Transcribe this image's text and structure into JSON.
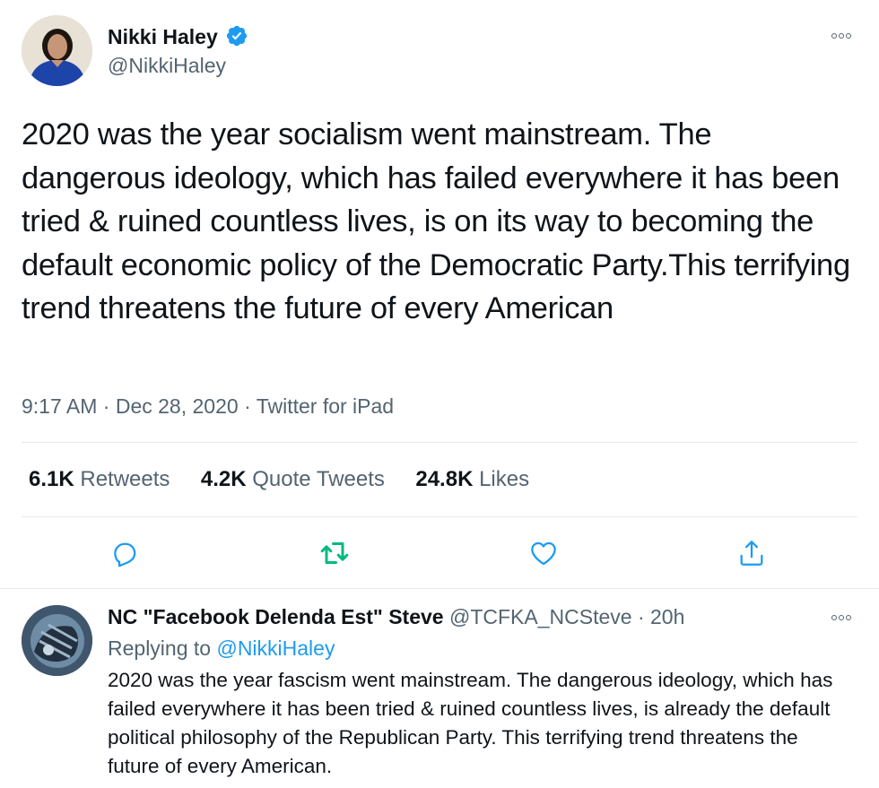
{
  "tweet": {
    "author_name": "Nikki Haley",
    "author_handle": "@NikkiHaley",
    "text": "2020 was the year socialism went mainstream. The dangerous ideology, which has failed everywhere it has been tried & ruined countless lives, is on its way to becoming the default economic policy of the Democratic Party.This terrifying trend threatens the future of every American",
    "time": "9:17 AM",
    "date": "Dec 28, 2020",
    "source": "Twitter for iPad",
    "stats": {
      "retweets_count": "6.1K",
      "retweets_label": "Retweets",
      "quotes_count": "4.2K",
      "quotes_label": "Quote Tweets",
      "likes_count": "24.8K",
      "likes_label": "Likes"
    }
  },
  "reply": {
    "author_name": "NC \"Facebook Delenda Est\" Steve",
    "author_handle": "@TCFKA_NCSteve",
    "time_ago": "20h",
    "replying_to_prefix": "Replying to",
    "replying_to_handle": "@NikkiHaley",
    "text": "2020 was the year fascism went mainstream. The dangerous ideology, which has failed everywhere it has been tried & ruined countless lives, is already the default political philosophy of the Republican Party. This terrifying trend threatens the future of every American."
  },
  "icons": {
    "verified": "verified-badge-icon",
    "more": "more-icon",
    "reply": "reply-icon",
    "retweet": "retweet-icon",
    "like": "heart-icon",
    "share": "share-icon"
  },
  "colors": {
    "accent_blue": "#1d9bf0",
    "retweet_green": "#00ba7c",
    "text_gray": "#536471"
  }
}
